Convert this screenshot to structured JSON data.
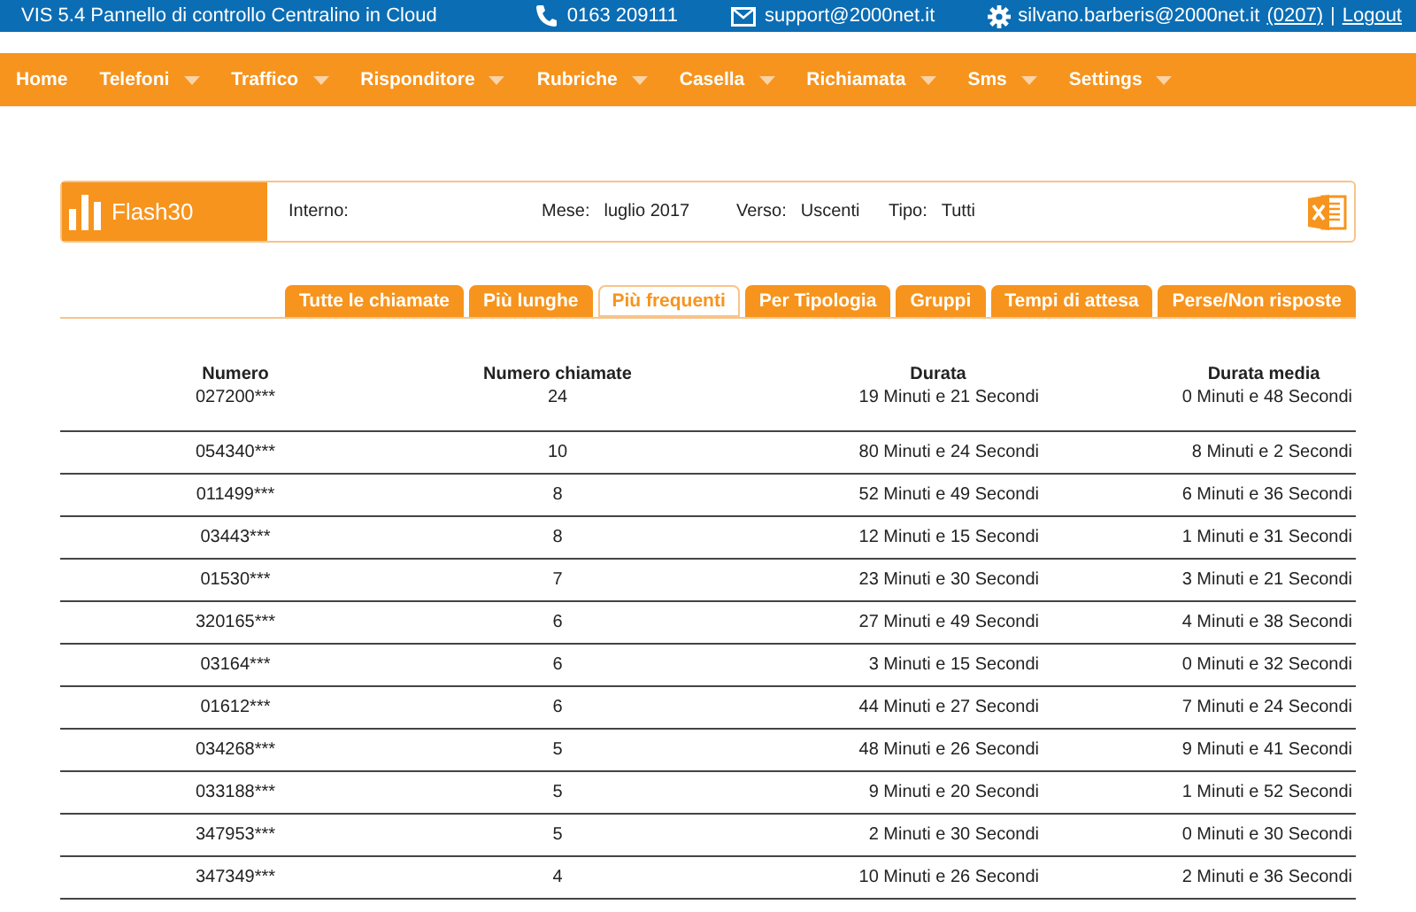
{
  "top_bar": {
    "title": "VIS 5.4 Pannello di controllo Centralino in Cloud",
    "phone": "0163 209111",
    "email": "support@2000net.it",
    "user": "silvano.barberis@2000net.it",
    "user_code": "(0207)",
    "separator": "|",
    "logout": "Logout"
  },
  "menu": [
    {
      "label": "Home",
      "dropdown": false
    },
    {
      "label": "Telefoni",
      "dropdown": true
    },
    {
      "label": "Traffico",
      "dropdown": true
    },
    {
      "label": "Risponditore",
      "dropdown": true
    },
    {
      "label": "Rubriche",
      "dropdown": true
    },
    {
      "label": "Casella",
      "dropdown": true
    },
    {
      "label": "Richiamata",
      "dropdown": true
    },
    {
      "label": "Sms",
      "dropdown": true
    },
    {
      "label": "Settings",
      "dropdown": true
    }
  ],
  "filter_card": {
    "title": "Flash30",
    "fields": [
      {
        "label": "Interno:"
      },
      {
        "label": "Mese:",
        "value": "luglio 2017"
      },
      {
        "label": "Verso:",
        "value": "Uscenti"
      },
      {
        "label": "Tipo:",
        "value": "Tutti"
      }
    ]
  },
  "tabs": [
    {
      "label": "Tutte le chiamate",
      "selected": false
    },
    {
      "label": "Più lunghe",
      "selected": false
    },
    {
      "label": "Più frequenti",
      "selected": true
    },
    {
      "label": "Per Tipologia",
      "selected": false
    },
    {
      "label": "Gruppi",
      "selected": false
    },
    {
      "label": "Tempi di attesa",
      "selected": false
    },
    {
      "label": "Perse/Non risposte",
      "selected": false
    }
  ],
  "table": {
    "columns": [
      "Numero",
      "Numero chiamate",
      "Durata",
      "Durata media"
    ],
    "rows": [
      [
        "027200***",
        "24",
        "19 Minuti e 21 Secondi",
        "0 Minuti e 48 Secondi"
      ],
      [
        "054340***",
        "10",
        "80 Minuti e 24 Secondi",
        "8 Minuti e 2 Secondi"
      ],
      [
        "011499***",
        "8",
        "52 Minuti e 49 Secondi",
        "6 Minuti e 36 Secondi"
      ],
      [
        "03443***",
        "8",
        "12 Minuti e 15 Secondi",
        "1 Minuti e 31 Secondi"
      ],
      [
        "01530***",
        "7",
        "23 Minuti e 30 Secondi",
        "3 Minuti e 21 Secondi"
      ],
      [
        "320165***",
        "6",
        "27 Minuti e 49 Secondi",
        "4 Minuti e 38 Secondi"
      ],
      [
        "03164***",
        "6",
        "3 Minuti e 15 Secondi",
        "0 Minuti e 32 Secondi"
      ],
      [
        "01612***",
        "6",
        "44 Minuti e 27 Secondi",
        "7 Minuti e 24 Secondi"
      ],
      [
        "034268***",
        "5",
        "48 Minuti e 26 Secondi",
        "9 Minuti e 41 Secondi"
      ],
      [
        "033188***",
        "5",
        "9 Minuti e 20 Secondi",
        "1 Minuti e 52 Secondi"
      ],
      [
        "347953***",
        "5",
        "2 Minuti e 30 Secondi",
        "0 Minuti e 30 Secondi"
      ],
      [
        "347349***",
        "4",
        "10 Minuti e 26 Secondi",
        "2 Minuti e 36 Secondi"
      ]
    ]
  }
}
